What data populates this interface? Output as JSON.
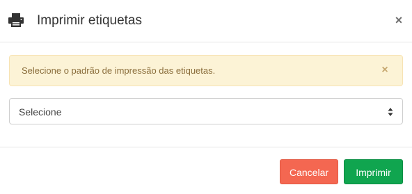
{
  "header": {
    "icon": "printer-icon",
    "title": "Imprimir etiquetas",
    "close_symbol": "×"
  },
  "alert": {
    "message": "Selecione o padrão de impressão das etiquetas.",
    "close_symbol": "×",
    "background": "#fcf3d6",
    "text_color": "#8a6d3b"
  },
  "select": {
    "value": "Selecione",
    "icon": "sort-arrows-icon"
  },
  "footer": {
    "cancel_label": "Cancelar",
    "cancel_color": "#f46751",
    "print_label": "Imprimir",
    "print_color": "#10a54f"
  }
}
